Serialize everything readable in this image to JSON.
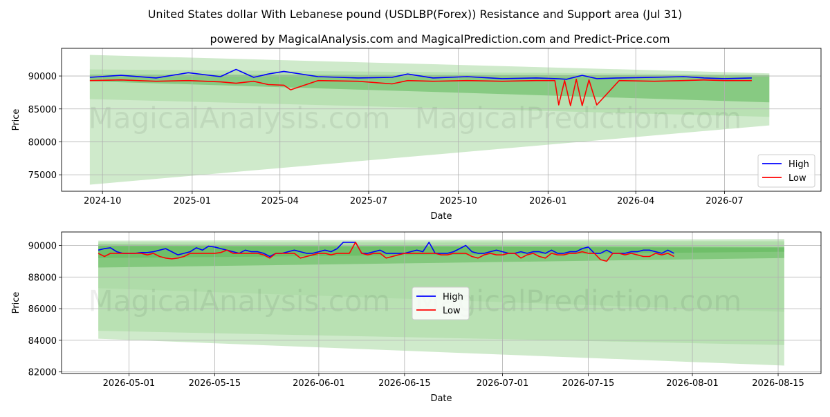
{
  "title": "United States dollar With Lebanese pound (USDLBP(Forex)) Resistance and Support area (Jul 31)",
  "subtitle": "powered by MagicalAnalysis.com and MagicalPrediction.com and Predict-Price.com",
  "watermarks": [
    "MagicalAnalysis.com",
    "MagicalPrediction.com"
  ],
  "colors": {
    "high": "#0000ff",
    "low": "#ff0000",
    "band_light": "#a8d8a0",
    "band_dark": "#5fb85a",
    "grid": "#b0b0b0"
  },
  "chart_data": [
    {
      "type": "line",
      "xlabel": "Date",
      "ylabel": "Price",
      "x_ticks": [
        "2024-10",
        "2025-01",
        "2025-04",
        "2025-07",
        "2025-10",
        "2026-01",
        "2026-04",
        "2026-07"
      ],
      "y_ticks": [
        75000,
        80000,
        85000,
        90000
      ],
      "ylim": [
        72500,
        94200
      ],
      "x_range": [
        "2024-08-20",
        "2026-10-08"
      ],
      "grid": true,
      "legend": {
        "position": "lower-right",
        "entries": [
          "High",
          "Low"
        ]
      },
      "bands": [
        {
          "shade": "light",
          "x": [
            "2024-09-18",
            "2026-08-16"
          ],
          "upper": [
            93200,
            90400
          ],
          "lower": [
            73500,
            82500
          ]
        },
        {
          "shade": "light",
          "x": [
            "2024-09-18",
            "2026-08-16"
          ],
          "upper": [
            91000,
            90200
          ],
          "lower": [
            86500,
            83800
          ]
        },
        {
          "shade": "dark",
          "x": [
            "2024-09-18",
            "2026-08-16"
          ],
          "upper": [
            90200,
            90100
          ],
          "lower": [
            89200,
            86000
          ]
        }
      ],
      "series": [
        {
          "name": "High",
          "x": [
            "2024-09-18",
            "2024-10-20",
            "2024-11-25",
            "2024-12-28",
            "2025-01-30",
            "2025-02-15",
            "2025-03-05",
            "2025-03-20",
            "2025-04-05",
            "2025-05-10",
            "2025-06-20",
            "2025-07-25",
            "2025-08-10",
            "2025-09-05",
            "2025-10-10",
            "2025-11-15",
            "2025-12-20",
            "2026-01-10",
            "2026-01-20",
            "2026-02-05",
            "2026-02-20",
            "2026-03-15",
            "2026-04-20",
            "2026-05-20",
            "2026-06-10",
            "2026-07-01",
            "2026-07-29"
          ],
          "values": [
            89800,
            90100,
            89700,
            90500,
            89900,
            91000,
            89800,
            90300,
            90700,
            89900,
            89700,
            89800,
            90300,
            89700,
            89900,
            89600,
            89700,
            89600,
            89500,
            90100,
            89600,
            89700,
            89800,
            89900,
            89700,
            89600,
            89700
          ]
        },
        {
          "name": "Low",
          "x": [
            "2024-09-18",
            "2024-10-20",
            "2024-11-25",
            "2024-12-28",
            "2025-01-30",
            "2025-02-15",
            "2025-03-05",
            "2025-03-20",
            "2025-04-05",
            "2025-04-12",
            "2025-05-10",
            "2025-06-20",
            "2025-07-25",
            "2025-08-10",
            "2025-09-05",
            "2025-10-10",
            "2025-11-15",
            "2025-12-20",
            "2026-01-08",
            "2026-01-12",
            "2026-01-18",
            "2026-01-24",
            "2026-01-30",
            "2026-02-05",
            "2026-02-12",
            "2026-02-20",
            "2026-03-15",
            "2026-04-20",
            "2026-05-20",
            "2026-06-10",
            "2026-07-01",
            "2026-07-29"
          ],
          "values": [
            89300,
            89400,
            89200,
            89300,
            89100,
            88900,
            89200,
            88700,
            88600,
            87900,
            89300,
            89200,
            88800,
            89300,
            89200,
            89300,
            89200,
            89300,
            89300,
            85600,
            89300,
            85500,
            89500,
            85500,
            89400,
            85600,
            89300,
            89200,
            89300,
            89400,
            89300,
            89300
          ]
        }
      ]
    },
    {
      "type": "line",
      "xlabel": "Date",
      "ylabel": "Price",
      "x_ticks": [
        "2026-05-01",
        "2026-05-15",
        "2026-06-01",
        "2026-06-15",
        "2026-07-01",
        "2026-07-15",
        "2026-08-01",
        "2026-08-15"
      ],
      "y_ticks": [
        82000,
        84000,
        86000,
        88000,
        90000
      ],
      "ylim": [
        81900,
        90850
      ],
      "x_range": [
        "2026-04-20",
        "2026-08-22"
      ],
      "grid": true,
      "legend": {
        "position": "center",
        "entries": [
          "High",
          "Low"
        ]
      },
      "bands": [
        {
          "shade": "light",
          "x": [
            "2026-04-26",
            "2026-08-16"
          ],
          "upper": [
            90300,
            90400
          ],
          "lower": [
            84100,
            82400
          ]
        },
        {
          "shade": "light",
          "x": [
            "2026-04-26",
            "2026-08-16"
          ],
          "upper": [
            90200,
            90300
          ],
          "lower": [
            84600,
            83700
          ]
        },
        {
          "shade": "light",
          "x": [
            "2026-04-26",
            "2026-08-16"
          ],
          "upper": [
            90100,
            90200
          ],
          "lower": [
            87300,
            85800
          ]
        },
        {
          "shade": "dark",
          "x": [
            "2026-04-26",
            "2026-08-16"
          ],
          "upper": [
            90050,
            89900
          ],
          "lower": [
            88600,
            89200
          ]
        },
        {
          "shade": "dark",
          "x": [
            "2026-04-26",
            "2026-08-16"
          ],
          "upper": [
            89950,
            89850
          ],
          "lower": [
            89200,
            89600
          ]
        }
      ],
      "series": [
        {
          "name": "High",
          "x": [
            "2026-04-26",
            "2026-04-27",
            "2026-04-28",
            "2026-04-29",
            "2026-04-30",
            "2026-05-01",
            "2026-05-02",
            "2026-05-03",
            "2026-05-04",
            "2026-05-05",
            "2026-05-06",
            "2026-05-07",
            "2026-05-08",
            "2026-05-09",
            "2026-05-10",
            "2026-05-11",
            "2026-05-12",
            "2026-05-13",
            "2026-05-14",
            "2026-05-15",
            "2026-05-16",
            "2026-05-17",
            "2026-05-18",
            "2026-05-19",
            "2026-05-20",
            "2026-05-21",
            "2026-05-22",
            "2026-05-23",
            "2026-05-24",
            "2026-05-25",
            "2026-05-26",
            "2026-05-27",
            "2026-05-28",
            "2026-05-29",
            "2026-05-30",
            "2026-05-31",
            "2026-06-01",
            "2026-06-02",
            "2026-06-03",
            "2026-06-04",
            "2026-06-05",
            "2026-06-06",
            "2026-06-07",
            "2026-06-08",
            "2026-06-09",
            "2026-06-10",
            "2026-06-11",
            "2026-06-12",
            "2026-06-13",
            "2026-06-14",
            "2026-06-15",
            "2026-06-16",
            "2026-06-17",
            "2026-06-18",
            "2026-06-19",
            "2026-06-20",
            "2026-06-21",
            "2026-06-22",
            "2026-06-23",
            "2026-06-24",
            "2026-06-25",
            "2026-06-26",
            "2026-06-27",
            "2026-06-28",
            "2026-06-29",
            "2026-06-30",
            "2026-07-01",
            "2026-07-02",
            "2026-07-03",
            "2026-07-04",
            "2026-07-05",
            "2026-07-06",
            "2026-07-07",
            "2026-07-08",
            "2026-07-09",
            "2026-07-10",
            "2026-07-11",
            "2026-07-12",
            "2026-07-13",
            "2026-07-14",
            "2026-07-15",
            "2026-07-16",
            "2026-07-17",
            "2026-07-18",
            "2026-07-19",
            "2026-07-20",
            "2026-07-21",
            "2026-07-22",
            "2026-07-23",
            "2026-07-24",
            "2026-07-25",
            "2026-07-26",
            "2026-07-27",
            "2026-07-28",
            "2026-07-29"
          ],
          "values": [
            89700,
            89800,
            89850,
            89600,
            89500,
            89500,
            89500,
            89550,
            89550,
            89600,
            89700,
            89800,
            89600,
            89400,
            89500,
            89600,
            89850,
            89700,
            89950,
            89900,
            89800,
            89700,
            89600,
            89500,
            89700,
            89600,
            89600,
            89500,
            89300,
            89500,
            89500,
            89600,
            89700,
            89600,
            89500,
            89500,
            89600,
            89700,
            89600,
            89800,
            90200,
            90200,
            90200,
            89500,
            89500,
            89600,
            89700,
            89500,
            89500,
            89500,
            89500,
            89600,
            89700,
            89600,
            90200,
            89500,
            89500,
            89500,
            89600,
            89800,
            90000,
            89600,
            89500,
            89500,
            89600,
            89700,
            89600,
            89500,
            89500,
            89600,
            89500,
            89600,
            89600,
            89500,
            89700,
            89500,
            89500,
            89600,
            89600,
            89800,
            89900,
            89500,
            89500,
            89700,
            89500,
            89500,
            89500,
            89600,
            89600,
            89700,
            89700,
            89600,
            89500,
            89700,
            89500
          ]
        },
        {
          "name": "Low",
          "x": [
            "2026-04-26",
            "2026-04-27",
            "2026-04-28",
            "2026-04-29",
            "2026-04-30",
            "2026-05-01",
            "2026-05-02",
            "2026-05-03",
            "2026-05-04",
            "2026-05-05",
            "2026-05-06",
            "2026-05-07",
            "2026-05-08",
            "2026-05-09",
            "2026-05-10",
            "2026-05-11",
            "2026-05-12",
            "2026-05-13",
            "2026-05-14",
            "2026-05-15",
            "2026-05-16",
            "2026-05-17",
            "2026-05-18",
            "2026-05-19",
            "2026-05-20",
            "2026-05-21",
            "2026-05-22",
            "2026-05-23",
            "2026-05-24",
            "2026-05-25",
            "2026-05-26",
            "2026-05-27",
            "2026-05-28",
            "2026-05-29",
            "2026-05-30",
            "2026-05-31",
            "2026-06-01",
            "2026-06-02",
            "2026-06-03",
            "2026-06-04",
            "2026-06-05",
            "2026-06-06",
            "2026-06-07",
            "2026-06-08",
            "2026-06-09",
            "2026-06-10",
            "2026-06-11",
            "2026-06-12",
            "2026-06-13",
            "2026-06-14",
            "2026-06-15",
            "2026-06-16",
            "2026-06-17",
            "2026-06-18",
            "2026-06-19",
            "2026-06-20",
            "2026-06-21",
            "2026-06-22",
            "2026-06-23",
            "2026-06-24",
            "2026-06-25",
            "2026-06-26",
            "2026-06-27",
            "2026-06-28",
            "2026-06-29",
            "2026-06-30",
            "2026-07-01",
            "2026-07-02",
            "2026-07-03",
            "2026-07-04",
            "2026-07-05",
            "2026-07-06",
            "2026-07-07",
            "2026-07-08",
            "2026-07-09",
            "2026-07-10",
            "2026-07-11",
            "2026-07-12",
            "2026-07-13",
            "2026-07-14",
            "2026-07-15",
            "2026-07-16",
            "2026-07-17",
            "2026-07-18",
            "2026-07-19",
            "2026-07-20",
            "2026-07-21",
            "2026-07-22",
            "2026-07-23",
            "2026-07-24",
            "2026-07-25",
            "2026-07-26",
            "2026-07-27",
            "2026-07-28",
            "2026-07-29"
          ],
          "values": [
            89500,
            89300,
            89500,
            89500,
            89500,
            89500,
            89500,
            89500,
            89400,
            89500,
            89300,
            89200,
            89150,
            89200,
            89300,
            89500,
            89500,
            89500,
            89500,
            89500,
            89550,
            89700,
            89500,
            89500,
            89500,
            89500,
            89500,
            89400,
            89200,
            89500,
            89500,
            89500,
            89500,
            89200,
            89300,
            89400,
            89500,
            89500,
            89400,
            89500,
            89500,
            89500,
            90200,
            89500,
            89400,
            89500,
            89500,
            89200,
            89300,
            89400,
            89500,
            89500,
            89500,
            89500,
            89500,
            89500,
            89400,
            89400,
            89500,
            89500,
            89500,
            89300,
            89200,
            89400,
            89500,
            89400,
            89400,
            89500,
            89500,
            89200,
            89400,
            89500,
            89300,
            89200,
            89500,
            89400,
            89400,
            89500,
            89500,
            89600,
            89500,
            89500,
            89100,
            89000,
            89500,
            89500,
            89400,
            89500,
            89400,
            89300,
            89300,
            89500,
            89400,
            89500,
            89300
          ]
        }
      ]
    }
  ]
}
